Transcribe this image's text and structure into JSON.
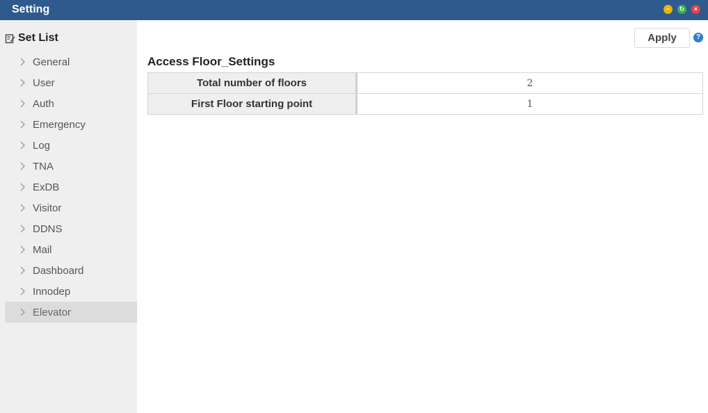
{
  "window": {
    "title": "Setting",
    "controls": {
      "minimize": "−",
      "restore": "↻",
      "close": "×"
    }
  },
  "sidebar": {
    "header": "Set List",
    "items": [
      {
        "label": "General"
      },
      {
        "label": "User"
      },
      {
        "label": "Auth"
      },
      {
        "label": "Emergency"
      },
      {
        "label": "Log"
      },
      {
        "label": "TNA"
      },
      {
        "label": "ExDB"
      },
      {
        "label": "Visitor"
      },
      {
        "label": "DDNS"
      },
      {
        "label": "Mail"
      },
      {
        "label": "Dashboard"
      },
      {
        "label": "Innodep"
      },
      {
        "label": "Elevator"
      }
    ],
    "selected": "Elevator"
  },
  "toolbar": {
    "apply_label": "Apply",
    "help_glyph": "?"
  },
  "main": {
    "section_title": "Access Floor_Settings",
    "rows": [
      {
        "label": "Total number of floors",
        "value": "2"
      },
      {
        "label": "First Floor starting point",
        "value": "1"
      }
    ]
  },
  "colors": {
    "titlebar": "#2f5a8e",
    "sidebar_bg": "#efefef",
    "selected_bg": "#dcdcdc",
    "help_icon": "#2f7ed0"
  }
}
